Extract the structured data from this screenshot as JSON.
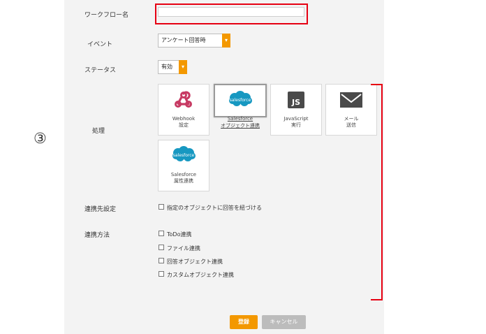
{
  "annotation_number": "③",
  "form": {
    "workflow_name_label": "ワークフロー名",
    "workflow_name_value": "",
    "event_label": "イベント",
    "event_value": "アンケート回答時",
    "status_label": "ステータス",
    "status_value": "有効",
    "process_label": "処理",
    "process_cards": [
      {
        "line1": "Webhook",
        "line2": "設定",
        "icon": "webhook-icon"
      },
      {
        "line1": "Salesforce",
        "line2": "オブジェクト連携",
        "icon": "salesforce-logo-icon",
        "logo_text": "salesforce"
      },
      {
        "line1": "JavaScript",
        "line2": "実行",
        "icon": "js-icon",
        "logo_text": "JS"
      },
      {
        "line1": "メール",
        "line2": "送信",
        "icon": "envelope-icon"
      },
      {
        "line1": "Salesforce",
        "line2": "属性連携",
        "icon": "salesforce-logo-icon",
        "logo_text": "salesforce"
      }
    ],
    "link_target_label": "連携先設定",
    "link_target_option": "指定のオブジェクトに回答を紐づける",
    "link_method_label": "連携方法",
    "link_methods": [
      "ToDo連携",
      "ファイル連携",
      "回答オブジェクト連携",
      "カスタムオブジェクト連携"
    ]
  },
  "buttons": {
    "register": "登録",
    "cancel": "キャンセル"
  },
  "colors": {
    "accent": "#f39800",
    "highlight": "#e60012",
    "salesforce": "#1798c1",
    "webhook": "#c73a63",
    "js_bg": "#4a4a4a"
  }
}
